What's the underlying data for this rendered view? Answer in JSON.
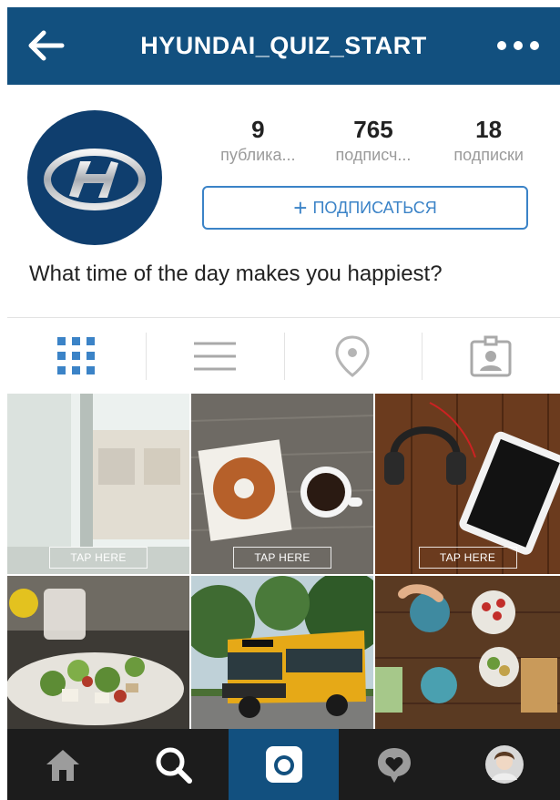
{
  "header": {
    "title": "HYUNDAI_QUIZ_START"
  },
  "profile": {
    "stats": [
      {
        "value": "9",
        "label": "публика..."
      },
      {
        "value": "765",
        "label": "подписч..."
      },
      {
        "value": "18",
        "label": "подписки"
      }
    ],
    "follow_label": "ПОДПИСАТЬСЯ",
    "bio": "What time of the day makes you happiest?"
  },
  "grid": {
    "tap_label": "TAP HERE"
  },
  "colors": {
    "brand_blue": "#12507f",
    "accent": "#3b83c7",
    "nav_bg": "#1c1c1c"
  },
  "icons": {
    "header": [
      "back-arrow-icon",
      "more-dots-icon"
    ],
    "tabs": [
      "grid-view-icon",
      "list-view-icon",
      "location-icon",
      "tagged-icon"
    ],
    "nav": [
      "home-icon",
      "search-icon",
      "camera-icon",
      "activity-icon",
      "profile-avatar-icon"
    ]
  }
}
